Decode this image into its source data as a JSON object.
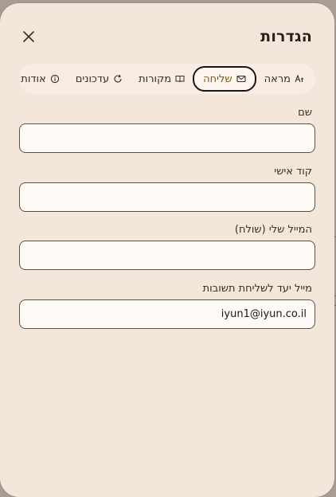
{
  "dialog": {
    "title": "הגדרות"
  },
  "tabs": [
    {
      "label": "מראה",
      "icon": "text-style-icon"
    },
    {
      "label": "שליחה",
      "icon": "mail-icon",
      "active": true
    },
    {
      "label": "מקורות",
      "icon": "book-icon"
    },
    {
      "label": "עדכונים",
      "icon": "refresh-icon"
    },
    {
      "label": "אודות",
      "icon": "info-icon"
    }
  ],
  "form": {
    "name_label": "שם",
    "name_value": "",
    "code_label": "קוד אישי",
    "code_value": "",
    "sender_label": "המייל שלי (שולח)",
    "sender_value": "",
    "target_label": "מייל יעד לשליחת תשובות",
    "target_value": "iyun1@iyun.co.il"
  },
  "colors": {
    "panel_bg": "#f3e6da",
    "active_tab_text": "#7b5a12",
    "input_border": "#5d5148"
  }
}
